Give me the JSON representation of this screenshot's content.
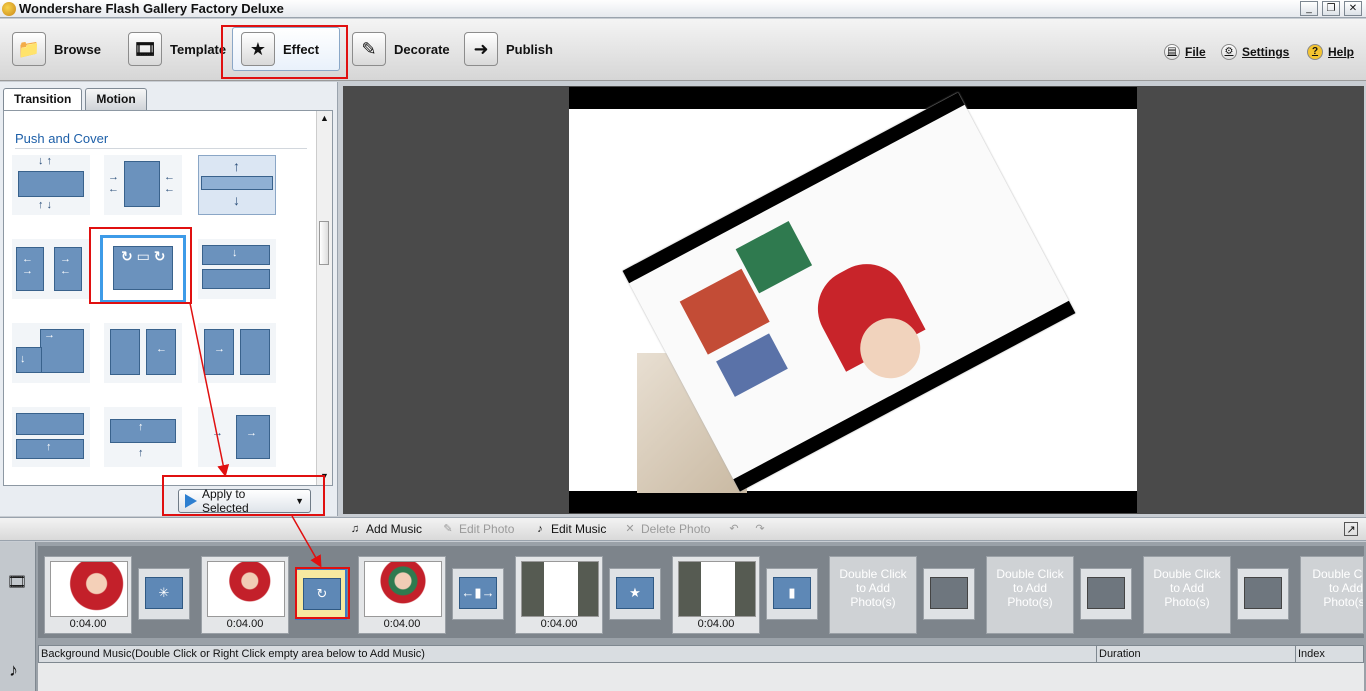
{
  "window": {
    "title": "Wondershare Flash Gallery Factory Deluxe",
    "minimize": "_",
    "restore": "❐",
    "close": "✕"
  },
  "toolbar": {
    "browse": "Browse",
    "template": "Template",
    "effect": "Effect",
    "decorate": "Decorate",
    "publish": "Publish",
    "file": "File",
    "settings": "Settings",
    "help": "Help"
  },
  "panel": {
    "tabs": [
      "Transition",
      "Motion"
    ],
    "section": "Push and Cover",
    "apply_button": "Apply to Selected"
  },
  "editbar": {
    "add_music": "Add Music",
    "edit_photo": "Edit Photo",
    "edit_music": "Edit Music",
    "delete_photo": "Delete Photo"
  },
  "timeline": {
    "slots": [
      {
        "duration": "0:04.00"
      },
      {
        "duration": "0:04.00"
      },
      {
        "duration": "0:04.00"
      },
      {
        "duration": "0:04.00"
      },
      {
        "duration": "0:04.00"
      }
    ],
    "empty_slot_text": [
      "Double Click",
      "to Add",
      "Photo(s)"
    ],
    "music_header": "Background Music(Double Click or Right Click empty area below to Add Music)",
    "duration_col": "Duration",
    "index_col": "Index"
  },
  "colors": {
    "accent": "#3d9be8",
    "highlight_red": "#e01010",
    "tile_blue": "#6b92bd"
  }
}
